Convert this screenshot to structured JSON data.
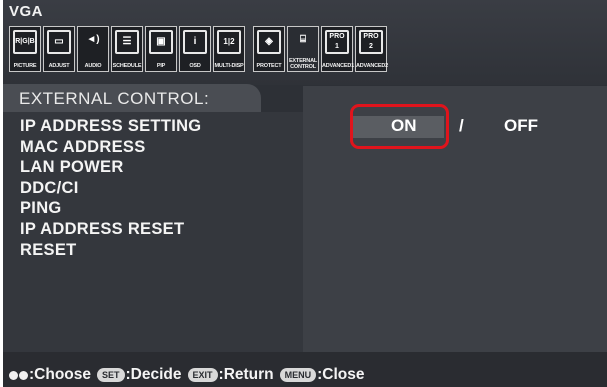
{
  "header": {
    "input": "VGA"
  },
  "tabs": [
    {
      "icon": "R|G|B",
      "label": "PICTURE"
    },
    {
      "icon": "▭",
      "label": "ADJUST"
    },
    {
      "icon": "◄)",
      "label": "AUDIO"
    },
    {
      "icon": "☰",
      "label": "SCHEDULE"
    },
    {
      "icon": "▣",
      "label": "PIP"
    },
    {
      "icon": "i",
      "label": "OSD"
    },
    {
      "icon": "1|2",
      "label": "MULTI-DISP"
    },
    {
      "icon": "◈",
      "label": "PROTECT"
    },
    {
      "icon": "⌸",
      "label": "EXTERNAL CONTROL"
    },
    {
      "icon": "PRO 1",
      "label": "ADVANCED1"
    },
    {
      "icon": "PRO 2",
      "label": "ADVANCED2"
    }
  ],
  "section": {
    "title": "EXTERNAL CONTROL:"
  },
  "menu": {
    "items": [
      "IP ADDRESS SETTING",
      "MAC ADDRESS",
      "LAN POWER",
      "DDC/CI",
      "PING",
      "IP ADDRESS RESET",
      "RESET"
    ]
  },
  "option": {
    "on": "ON",
    "separator": "/",
    "off": "OFF"
  },
  "footer": {
    "choose": ":Choose",
    "set_key": "SET",
    "decide": ":Decide",
    "exit_key": "EXIT",
    "return": ":Return",
    "menu_key": "MENU",
    "close": ":Close"
  },
  "colors": {
    "highlight": "#e0141c",
    "background": "#2d3036"
  }
}
